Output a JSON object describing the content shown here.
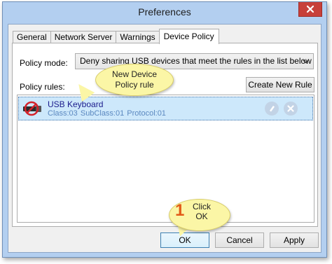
{
  "window": {
    "title": "Preferences"
  },
  "tabs": [
    {
      "label": "General"
    },
    {
      "label": "Network Server"
    },
    {
      "label": "Warnings"
    },
    {
      "label": "Device Policy"
    }
  ],
  "policy_mode": {
    "label": "Policy mode:",
    "selected": "Deny sharing USB devices that meet the rules in the list below"
  },
  "policy_rules": {
    "label": "Policy rules:",
    "create_button": "Create New Rule",
    "rules": [
      {
        "name": "USB Keyboard",
        "description": "Class:03  SubClass:01  Protocol:01",
        "icon": "usb-device-denied-icon"
      }
    ]
  },
  "callouts": {
    "new_rule": "New Device\nPolicy rule",
    "step_number": "1",
    "ok_hint": "Click\nOK"
  },
  "buttons": {
    "ok": "OK",
    "cancel": "Cancel",
    "apply": "Apply"
  },
  "colors": {
    "selected_row": "#cde8fb",
    "close_button": "#c7403a",
    "callout": "#fbf6a6",
    "step_number": "#e25b18"
  }
}
